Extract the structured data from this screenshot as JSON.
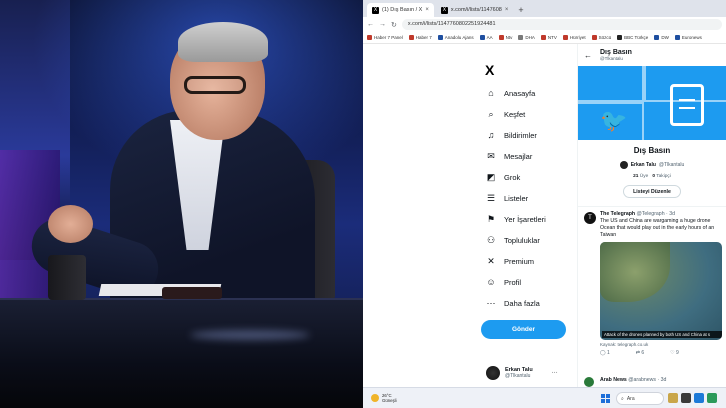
{
  "browser": {
    "tabs": [
      {
        "label": "(1) Dış Basın / X",
        "active": true
      },
      {
        "label": "x.com/i/lists/1147608",
        "active": false
      }
    ],
    "new_tab": "+",
    "url": "x.com/i/lists/1147760802251924481",
    "bookmarks": [
      {
        "label": "Haber 7 Panel",
        "color": "#c0392b"
      },
      {
        "label": "Haber 7",
        "color": "#c0392b"
      },
      {
        "label": "Anadolu Ajans",
        "color": "#1f4fa0"
      },
      {
        "label": "AA",
        "color": "#1f4fa0"
      },
      {
        "label": "Ntv",
        "color": "#c0392b"
      },
      {
        "label": "DHA",
        "color": "#7a7a7a"
      },
      {
        "label": "NTV",
        "color": "#c0392b"
      },
      {
        "label": "Hürriyet",
        "color": "#c0392b"
      },
      {
        "label": "Sözcü",
        "color": "#c0392b"
      },
      {
        "label": "BBC Türkçe",
        "color": "#222222"
      },
      {
        "label": "DW",
        "color": "#1f4fa0"
      },
      {
        "label": "Euronews",
        "color": "#1f4fa0"
      }
    ]
  },
  "sidebar": {
    "brand": "X",
    "items": [
      {
        "icon": "home-icon",
        "glyph": "⌂",
        "label": "Anasayfa"
      },
      {
        "icon": "search-icon",
        "glyph": "⌕",
        "label": "Keşfet"
      },
      {
        "icon": "bell-icon",
        "glyph": "♫",
        "label": "Bildirimler"
      },
      {
        "icon": "mail-icon",
        "glyph": "✉",
        "label": "Mesajlar"
      },
      {
        "icon": "grok-icon",
        "glyph": "◩",
        "label": "Grok"
      },
      {
        "icon": "lists-icon",
        "glyph": "☰",
        "label": "Listeler"
      },
      {
        "icon": "bookmark-icon",
        "glyph": "⚑",
        "label": "Yer İşaretleri"
      },
      {
        "icon": "communities-icon",
        "glyph": "⚇",
        "label": "Topluluklar"
      },
      {
        "icon": "premium-icon",
        "glyph": "✕",
        "label": "Premium"
      },
      {
        "icon": "profile-icon",
        "glyph": "☺",
        "label": "Profil"
      },
      {
        "icon": "more-icon",
        "glyph": "⋯",
        "label": "Daha fazla"
      }
    ],
    "post_button": "Gönder",
    "account": {
      "name": "Erkan Talu",
      "handle": "@Tlkantalu",
      "more": "···"
    }
  },
  "list": {
    "header_title": "Dış Basın",
    "header_handle": "@Tlkantalu",
    "name": "Dış Basın",
    "owner_name": "Erkan Talu",
    "owner_handle": "@Tlkantalu",
    "members_count": "21",
    "members_label": "Üye",
    "followers_count": "0",
    "followers_label": "Takipçi",
    "edit_button": "Listeyi Düzenle"
  },
  "tweet": {
    "author": "The Telegraph",
    "handle": "@Telegraph · 3d",
    "text": "The US and China are wargaming a huge drone Ocean that would play out in the early hours of an Taiwan",
    "media_caption": "Attack of the drones planned by both US and China at s",
    "source": "Kaynak: telegraph.co.uk",
    "replies": "1",
    "retweets": "6",
    "likes": "9"
  },
  "tweet2": {
    "author": "Arab News",
    "handle": "@arabnews · 3d"
  },
  "taskbar": {
    "temp": "26°C",
    "condition": "Güneşli",
    "search_label": "Ara"
  },
  "colors": {
    "accent": "#1d9bf0",
    "text": "#0f1419",
    "muted": "#536471"
  }
}
